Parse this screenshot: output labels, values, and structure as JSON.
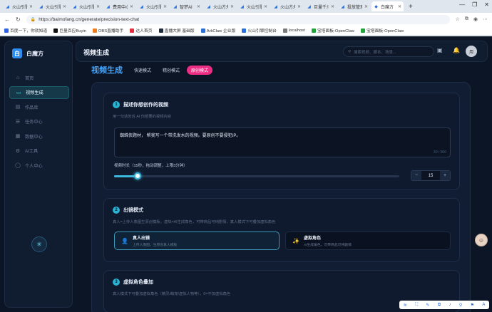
{
  "browser": {
    "tabs": [
      {
        "label": "火山引擎",
        "active": false
      },
      {
        "label": "火山引擎",
        "active": false
      },
      {
        "label": "火山引擎",
        "active": false
      },
      {
        "label": "费用中心",
        "active": false
      },
      {
        "label": "火山引擎",
        "active": false
      },
      {
        "label": "智梦AI",
        "active": false
      },
      {
        "label": "火山方舟",
        "active": false
      },
      {
        "label": "火山引擎",
        "active": false
      },
      {
        "label": "火山方舟",
        "active": false
      },
      {
        "label": "巨量千川",
        "active": false
      },
      {
        "label": "投放管理",
        "active": false
      },
      {
        "label": "白魔方",
        "active": true
      }
    ],
    "new_tab": "+",
    "window_controls": [
      "—",
      "❐",
      "✕"
    ],
    "url": "https://baimofang.cn/generate/precision-text-chat",
    "bookmarks": [
      {
        "label": "百度一下，你就知道",
        "color": "#2f62e0"
      },
      {
        "label": "巨量百应Buyin",
        "color": "#111111"
      },
      {
        "label": "OBS直播助手",
        "color": "#f07b1c"
      },
      {
        "label": "达人首页",
        "color": "#e0303d"
      },
      {
        "label": "直播大屏 基础版",
        "color": "#1f2b3a"
      },
      {
        "label": "ArkClaw 企业版",
        "color": "#2a6fdb"
      },
      {
        "label": "火山引擎控制台",
        "color": "#2a6fdb"
      },
      {
        "label": "localhost",
        "color": "#7a7a7a"
      },
      {
        "label": "宝塔面板-OpenClaw",
        "color": "#20a53a"
      },
      {
        "label": "宝塔面板-OpenClaw",
        "color": "#20a53a"
      }
    ]
  },
  "sidebar": {
    "brand_logo": "白",
    "brand_name": "白魔方",
    "items": [
      {
        "label": "首页",
        "icon": "⌂",
        "active": false
      },
      {
        "label": "视频生成",
        "icon": "▭",
        "active": true
      },
      {
        "label": "作品库",
        "icon": "▤",
        "active": false
      },
      {
        "label": "任务中心",
        "icon": "☰",
        "active": false
      },
      {
        "label": "数据中心",
        "icon": "▦",
        "active": false
      },
      {
        "label": "AI工具",
        "icon": "⚙",
        "active": false
      },
      {
        "label": "个人中心",
        "icon": "◯",
        "active": false
      }
    ],
    "fab_icon": "✳"
  },
  "topbar": {
    "title": "视频生成",
    "search_placeholder": "搜索视频、脚本、场景...",
    "avatar": "用"
  },
  "section": {
    "title": "视频生成",
    "modes": [
      {
        "label": "快速模式",
        "active": false
      },
      {
        "label": "精创模式",
        "active": false
      },
      {
        "label": "原创模式",
        "active": true
      }
    ]
  },
  "step1": {
    "number": "1",
    "title": "描述你想创作的视频",
    "subtitle": "用一句话告诉 AI 你想要的视频内容",
    "prompt": "蜘蛛侠题材，  帮我写一个带洗发水的视频。要原创不要侵犯IP。",
    "counter": "30 / 500",
    "duration_label": "视频时长（15秒，拖动调整，上限3分钟）",
    "duration_value": "15",
    "duration_fraction": 0.083,
    "minus": "−",
    "plus": "+"
  },
  "step2": {
    "number": "2",
    "title": "出镜模式",
    "subtitle": "真人=上传人像图生原创模板，虚拟=AI生成角色，可带商品可纯剧情，真人模式下可叠加虚拟角色",
    "options": [
      {
        "name": "真人出镜",
        "desc": "上传人像图，生原创真人模板",
        "icon": "👤"
      },
      {
        "name": "虚拟角色",
        "desc": "AI生成角色，可带商品可纯剧情",
        "icon": "✨"
      }
    ]
  },
  "step3": {
    "number": "3",
    "title": "虚拟角色叠加",
    "subtitle": "真人模式下可叠加虚拟角色（精灵/萌宠/虚拟人物等），0=不加虚拟角色"
  },
  "tray": {
    "icons": [
      "≋",
      "⛶",
      "✎",
      "⧉",
      "♪",
      "⚲",
      "⚑",
      "A"
    ]
  }
}
